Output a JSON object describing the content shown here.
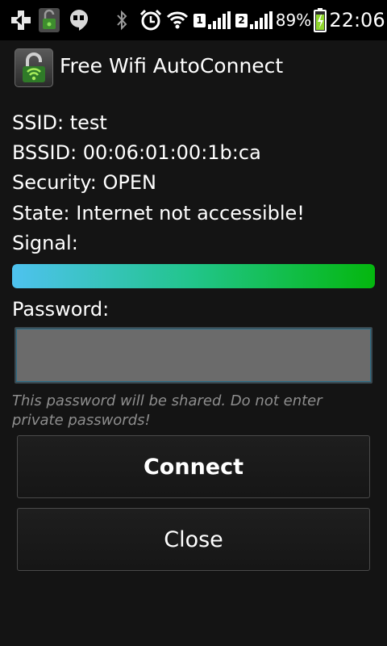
{
  "status_bar": {
    "icons": {
      "usb": "usb-debug-icon",
      "app": "app-notification-icon",
      "hangouts": "hangouts-icon",
      "bluetooth": "bluetooth-icon",
      "alarm": "alarm-clock-icon",
      "wifi": "wifi-icon",
      "signal": "cell-signal-icon",
      "battery": "battery-charging-icon"
    },
    "sim1_label": "1",
    "sim2_label": "2",
    "battery_percent": "89%",
    "battery_level": 0.89,
    "time": "22:06"
  },
  "app": {
    "title": "Free Wifi AutoConnect",
    "logo_icon": "open-padlock-wifi-icon"
  },
  "network": {
    "ssid_text": "SSID: test",
    "bssid_text": "BSSID: 00:06:01:00:1b:ca",
    "security_text": "Security: OPEN",
    "state_text": "State: Internet not accessible!",
    "signal_label": "Signal:",
    "signal_level": 1.0,
    "signal_colors": [
      "#4ec2ef",
      "#21c58a",
      "#04b70e"
    ]
  },
  "password": {
    "label": "Password:",
    "value": "",
    "placeholder": "",
    "hint": "This password will be shared. Do not enter private passwords!"
  },
  "buttons": {
    "connect_label": "Connect",
    "close_label": "Close"
  }
}
